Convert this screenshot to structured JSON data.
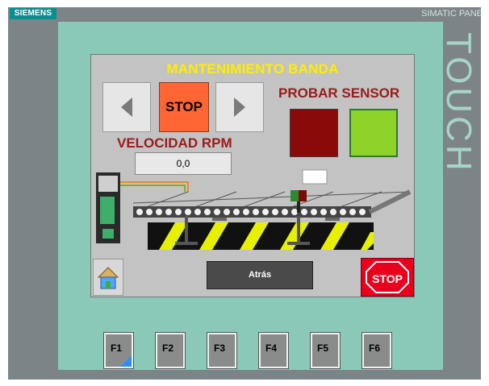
{
  "device": {
    "brand": "SIEMENS",
    "model": "SIMATIC PANE",
    "side_label": "TOUCH"
  },
  "screen": {
    "title": "MANTENIMIENTO BANDA",
    "left_arrow_icon": "triangle-left-icon",
    "right_arrow_icon": "triangle-right-icon",
    "stop_label": "STOP",
    "probar_sensor_label": "PROBAR SENSOR",
    "sensor_indicators": [
      {
        "name": "sensor-red",
        "color": "#8a0a0a"
      },
      {
        "name": "sensor-green",
        "color": "#8fd32a"
      }
    ],
    "velocity_label": "VELOCIDAD RPM",
    "velocity_value": "0,0",
    "home_icon": "house-icon",
    "back_label": "Atrás",
    "stop_sign_label": "STOP"
  },
  "function_keys": [
    "F1",
    "F2",
    "F3",
    "F4",
    "F5",
    "F6"
  ],
  "colors": {
    "title": "#ffee00",
    "section_label": "#9b1b1b",
    "stop_button": "#ff6633",
    "stop_sign": "#e8001c",
    "screen_bg": "#c3c3c3",
    "bezel_teal": "#8ac8b8"
  }
}
